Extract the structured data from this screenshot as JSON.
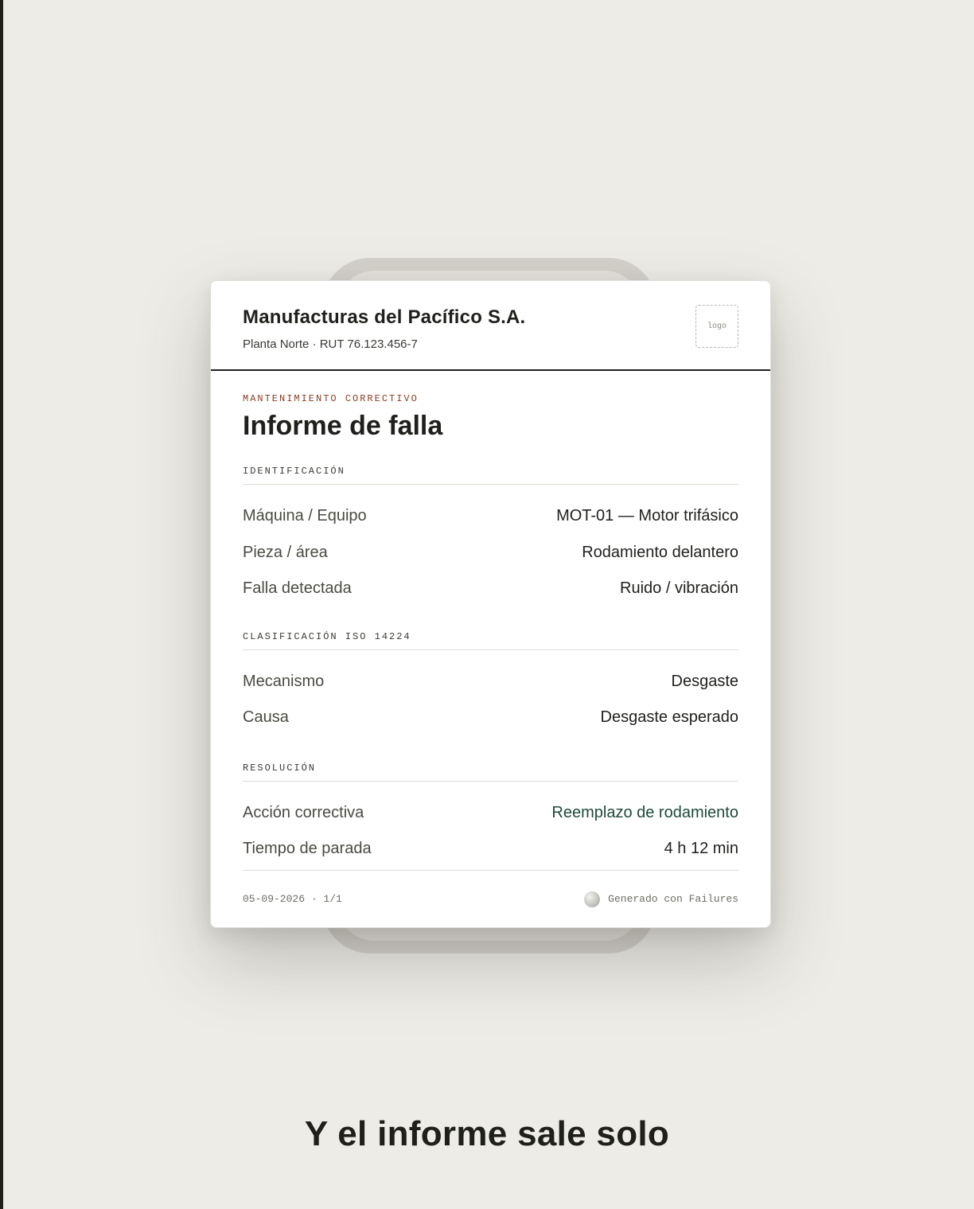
{
  "report": {
    "company": "Manufacturas del Pacífico S.A.",
    "subline": "Planta Norte · RUT 76.123.456-7",
    "logo_placeholder": "logo",
    "eyebrow": "MANTENIMIENTO CORRECTIVO",
    "title": "Informe de falla",
    "sections": [
      {
        "heading": "IDENTIFICACIÓN",
        "rows": [
          {
            "label": "Máquina / Equipo",
            "value": "MOT-01 — Motor trifásico"
          },
          {
            "label": "Pieza / área",
            "value": "Rodamiento delantero"
          },
          {
            "label": "Falla detectada",
            "value": "Ruido / vibración"
          }
        ]
      },
      {
        "heading": "CLASIFICACIÓN ISO 14224",
        "rows": [
          {
            "label": "Mecanismo",
            "value": "Desgaste"
          },
          {
            "label": "Causa",
            "value": "Desgaste esperado"
          }
        ]
      },
      {
        "heading": "RESOLUCIÓN",
        "rows": [
          {
            "label": "Acción correctiva",
            "value": "Reemplazo de rodamiento"
          },
          {
            "label": "Tiempo de parada",
            "value": "4 h 12 min"
          }
        ]
      }
    ],
    "footer": {
      "date_page": "05-09-2026 · 1/1",
      "generated_by": "Generado con Failures"
    }
  },
  "tagline": "Y el informe sale solo",
  "colors": {
    "background": "#edece6",
    "eyebrow": "#8a3c22",
    "accent_value": "#1d4a3a",
    "ink": "#1f1f1c"
  }
}
